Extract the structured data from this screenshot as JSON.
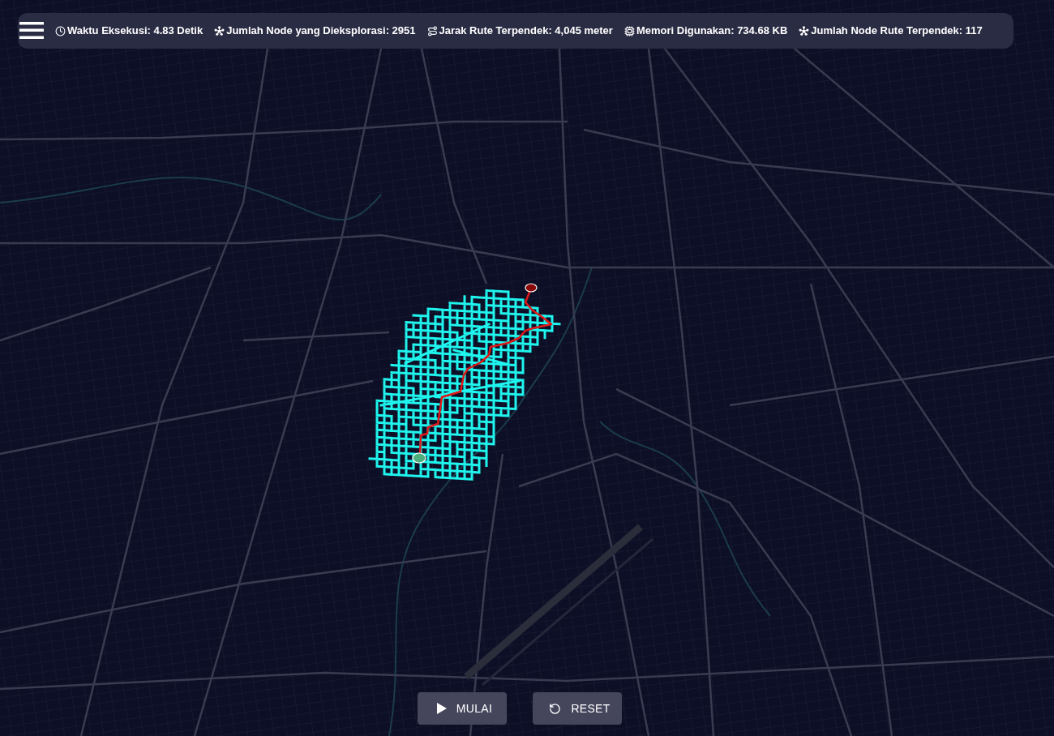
{
  "stats_bar": {
    "stats": [
      {
        "kind": "time",
        "text": "Waktu Eksekusi: 4.83 Detik"
      },
      {
        "kind": "nodes",
        "text": "Jumlah Node yang Dieksplorasi: 2951"
      },
      {
        "kind": "distance",
        "text": "Jarak Rute Terpendek: 4,045 meter"
      },
      {
        "kind": "memory",
        "text": "Memori Digunakan: 734.68 KB"
      },
      {
        "kind": "nodes",
        "text": "Jumlah Node Rute Terpendek: 117"
      }
    ]
  },
  "controls": [
    {
      "kind": "play",
      "label": "MULAI"
    },
    {
      "kind": "reset",
      "label": "RESET"
    }
  ]
}
